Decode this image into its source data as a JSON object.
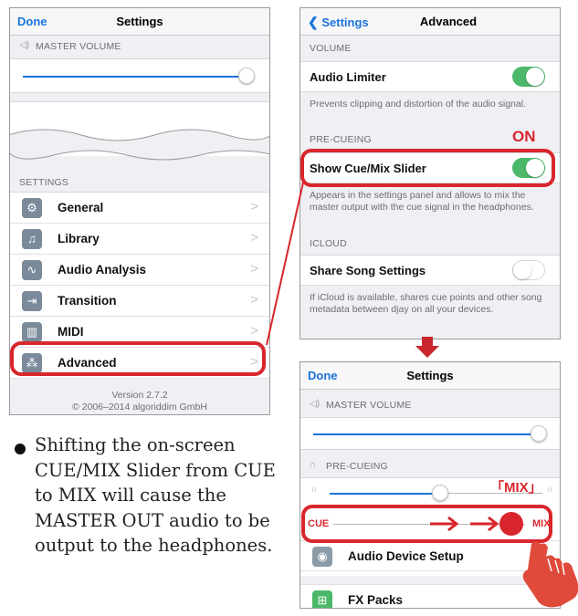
{
  "left_panel": {
    "nav_done": "Done",
    "nav_title": "Settings",
    "master_volume_header": "MASTER VOLUME",
    "master_volume_level": 0.98,
    "settings_header": "SETTINGS",
    "items": [
      {
        "label": "General",
        "icon": "gear-icon",
        "glyph": "⚙",
        "color": "#7d8b99"
      },
      {
        "label": "Library",
        "icon": "music-note-icon",
        "glyph": "♫",
        "color": "#7d8b99"
      },
      {
        "label": "Audio Analysis",
        "icon": "waveform-icon",
        "glyph": "∿",
        "color": "#7d8b99"
      },
      {
        "label": "Transition",
        "icon": "transition-icon",
        "glyph": "⇥",
        "color": "#7d8b99"
      },
      {
        "label": "MIDI",
        "icon": "midi-keys-icon",
        "glyph": "▥",
        "color": "#7d8b99"
      },
      {
        "label": "Advanced",
        "icon": "advanced-icon",
        "glyph": "⁂",
        "color": "#7d8b99"
      }
    ],
    "chevron": ">",
    "version": "Version 2.7.2",
    "copyright": "© 2006–2014 algoriddim GmbH"
  },
  "right_panel": {
    "back_label": "Settings",
    "nav_title": "Advanced",
    "volume_header": "VOLUME",
    "audio_limiter_label": "Audio Limiter",
    "audio_limiter_on": true,
    "audio_limiter_desc": "Prevents clipping and distortion of the audio signal.",
    "precueing_header": "PRE-CUEING",
    "on_annotation": "ON",
    "show_cue_label": "Show Cue/Mix Slider",
    "show_cue_on": true,
    "show_cue_desc": "Appears in the settings panel and allows to mix the master output with the cue signal in the headphones.",
    "icloud_header": "ICLOUD",
    "share_song_label": "Share Song Settings",
    "share_song_on": false,
    "share_song_desc": "If iCloud is available, shares cue points and other song metadata between djay on all your devices."
  },
  "bottom_panel": {
    "nav_done": "Done",
    "nav_title": "Settings",
    "master_volume_header": "MASTER VOLUME",
    "master_volume_level": 0.98,
    "precueing_header": "PRE-CUEING",
    "precue_level": 0.6,
    "mix_annotation": "「MIX」",
    "cue_label": "CUE",
    "mix_label": "MIX",
    "audio_device_label": "Audio Device Setup",
    "fx_packs_label": "FX Packs"
  },
  "note": "Shifting the on-screen CUE/MIX Slider from CUE to MIX will cause the MASTER OUT audio to be output to the headphones.",
  "colors": {
    "accent": "#1a73d9",
    "highlight": "#d8262c",
    "toggle_on": "#4cb86a"
  }
}
